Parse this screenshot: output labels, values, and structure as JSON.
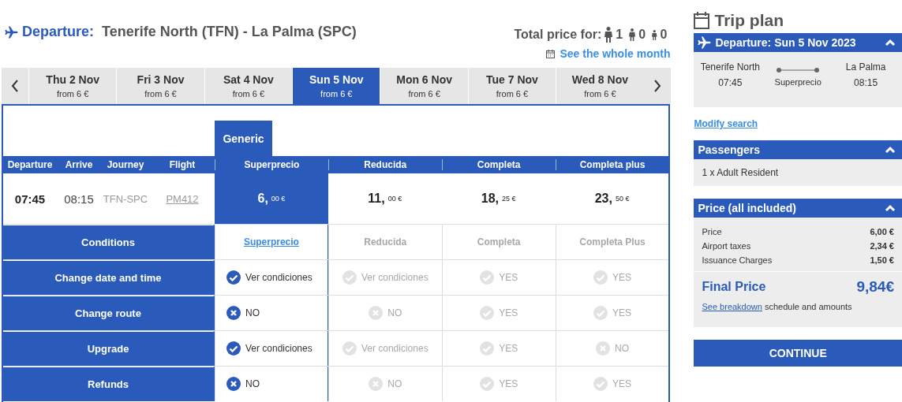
{
  "header": {
    "label": "Departure:",
    "route": "Tenerife North (TFN) - La Palma (SPC)",
    "total_label": "Total price for:",
    "passengers": [
      {
        "kind": "adult",
        "count": "1"
      },
      {
        "kind": "child",
        "count": "0"
      },
      {
        "kind": "infant",
        "count": "0"
      }
    ],
    "month_link": "See the whole month"
  },
  "dates": [
    {
      "day": "Thu 2 Nov",
      "price": "from 6 €",
      "selected": false
    },
    {
      "day": "Fri 3 Nov",
      "price": "from 6 €",
      "selected": false
    },
    {
      "day": "Sat 4 Nov",
      "price": "from 6 €",
      "selected": false
    },
    {
      "day": "Sun 5 Nov",
      "price": "from 6 €",
      "selected": true
    },
    {
      "day": "Mon 6 Nov",
      "price": "from 6 €",
      "selected": false
    },
    {
      "day": "Tue 7 Nov",
      "price": "from 6 €",
      "selected": false
    },
    {
      "day": "Wed 8 Nov",
      "price": "from 6 €",
      "selected": false
    }
  ],
  "group_tab": "Generic",
  "flight_columns": [
    "Departure",
    "Arrive",
    "Journey",
    "Flight"
  ],
  "flight": {
    "departure": "07:45",
    "arrive": "08:15",
    "journey": "TFN-SPC",
    "flight": "PM412"
  },
  "fares": [
    {
      "name": "Superprecio",
      "whole": "6,",
      "cents": "00 €",
      "condition_name": "Superprecio",
      "selected": true
    },
    {
      "name": "Reducida",
      "whole": "11,",
      "cents": "00 €",
      "condition_name": "Reducida",
      "selected": false
    },
    {
      "name": "Completa",
      "whole": "18,",
      "cents": "25 €",
      "condition_name": "Completa",
      "selected": false
    },
    {
      "name": "Completa plus",
      "whole": "23,",
      "cents": "50 €",
      "condition_name": "Completa Plus",
      "selected": false
    }
  ],
  "conditions_label": "Conditions",
  "conditions": [
    {
      "name": "Change date and time",
      "cells": [
        {
          "kind": "yes",
          "text": "Ver condiciones"
        },
        {
          "kind": "yes",
          "text": "Ver condiciones"
        },
        {
          "kind": "yes",
          "text": "YES"
        },
        {
          "kind": "yes",
          "text": "YES"
        }
      ]
    },
    {
      "name": "Change route",
      "cells": [
        {
          "kind": "no",
          "text": "NO"
        },
        {
          "kind": "no",
          "text": "NO"
        },
        {
          "kind": "yes",
          "text": "YES"
        },
        {
          "kind": "yes",
          "text": "YES"
        }
      ]
    },
    {
      "name": "Upgrade",
      "cells": [
        {
          "kind": "yes",
          "text": "Ver condiciones"
        },
        {
          "kind": "yes",
          "text": "Ver condiciones"
        },
        {
          "kind": "yes",
          "text": "YES"
        },
        {
          "kind": "no",
          "text": "NO"
        }
      ]
    },
    {
      "name": "Refunds",
      "cells": [
        {
          "kind": "no",
          "text": "NO"
        },
        {
          "kind": "no",
          "text": "NO"
        },
        {
          "kind": "yes",
          "text": "YES"
        },
        {
          "kind": "yes",
          "text": "YES"
        }
      ]
    }
  ],
  "trip_plan": {
    "title": "Trip plan",
    "departure_title": "Departure: Sun 5 Nov 2023",
    "from": "Tenerife North",
    "from_time": "07:45",
    "to": "La Palma",
    "to_time": "08:15",
    "fare": "Superprecio",
    "modify": "Modify search",
    "passengers_title": "Passengers",
    "passengers": "1 x Adult Resident",
    "price_title": "Price (all included)",
    "price_lines": [
      {
        "label": "Price",
        "amount": "6,00 €"
      },
      {
        "label": "Airport taxes",
        "amount": "2,34 €"
      },
      {
        "label": "Issuance Charges",
        "amount": "1,50 €"
      }
    ],
    "final_label": "Final Price",
    "final_amount": "9,84€",
    "breakdown_link": "See breakdown",
    "breakdown_text": "schedule and amounts",
    "continue": "CONTINUE"
  }
}
